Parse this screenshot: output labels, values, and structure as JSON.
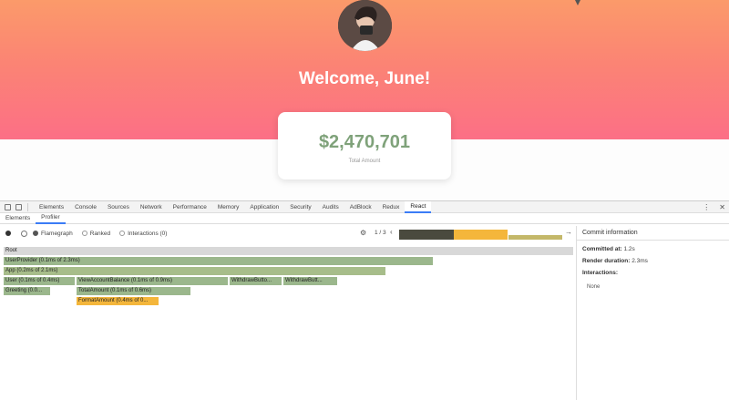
{
  "app": {
    "welcome": "Welcome, June!",
    "card": {
      "amount": "$2,470,701",
      "label": "Total Amount"
    },
    "colors": {
      "gradient_top": "#fb9a6a",
      "gradient_bottom": "#fc6f86",
      "amount": "#7fa27a"
    }
  },
  "devtools": {
    "tabs": [
      "Elements",
      "Console",
      "Sources",
      "Network",
      "Performance",
      "Memory",
      "Application",
      "Security",
      "Audits",
      "AdBlock",
      "Redux",
      "React"
    ],
    "active_tab": "React",
    "subtabs": [
      "Elements",
      "Profiler"
    ],
    "active_subtab": "Profiler",
    "modes": {
      "flamegraph": "Flamegraph",
      "ranked": "Ranked",
      "interactions": "Interactions (0)"
    },
    "commit_counter": "1 / 3",
    "flamegraph": {
      "nodes": [
        {
          "label": "Root",
          "color": "#d8d8d8"
        },
        {
          "label": "UserProvider (0.1ms of 2.3ms)",
          "color": "#9bb78c"
        },
        {
          "label": "App (0.2ms of 2.1ms)",
          "color": "#a7bd8a"
        },
        {
          "label": "User (0.1ms of 0.4ms)",
          "color": "#9bb78c"
        },
        {
          "label": "ViewAccountBalance (0.1ms of 0.9ms)",
          "color": "#9bb78c"
        },
        {
          "label": "WithdrawButto...",
          "color": "#9bb78c"
        },
        {
          "label": "WithdrawButt...",
          "color": "#9bb78c"
        },
        {
          "label": "Greeting (0.0...",
          "color": "#9bb78c"
        },
        {
          "label": "TotalAmount (0.1ms of 0.6ms)",
          "color": "#9bb78c"
        },
        {
          "label": "FormatAmount (0.4ms of 0...",
          "color": "#f4b63b"
        }
      ]
    },
    "commit_info": {
      "title": "Commit information",
      "committed_at_label": "Committed at:",
      "committed_at": "1.2s",
      "render_duration_label": "Render duration:",
      "render_duration": "2.3ms",
      "interactions_label": "Interactions:",
      "interactions_value": "None"
    }
  }
}
